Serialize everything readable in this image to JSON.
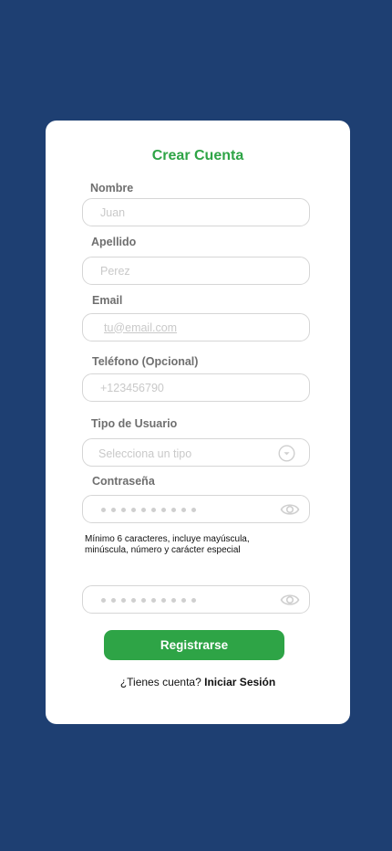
{
  "form": {
    "title": "Crear Cuenta",
    "nombre": {
      "label": "Nombre",
      "placeholder": "Juan"
    },
    "apellido": {
      "label": "Apellido",
      "placeholder": "Perez"
    },
    "email": {
      "label": "Email",
      "placeholder": "tu@email.com"
    },
    "telefono": {
      "label": "Teléfono (Opcional)",
      "placeholder": "+123456790"
    },
    "tipo_usuario": {
      "label": "Tipo de Usuario",
      "selected": "Selecciona un tipo"
    },
    "contrasena": {
      "label": "Contraseña",
      "hint": "Mínimo 6 caracteres, incluye mayúscula, minúscula, número y carácter especial"
    },
    "submit_label": "Registrarse",
    "login_prompt": "¿Tienes cuenta?",
    "login_link": "Iniciar Sesión"
  },
  "colors": {
    "background": "#1e3f72",
    "accent": "#2ea446",
    "card": "#ffffff"
  },
  "icons": {
    "select": "chevron-down-icon",
    "password_toggle": "eye-icon"
  }
}
